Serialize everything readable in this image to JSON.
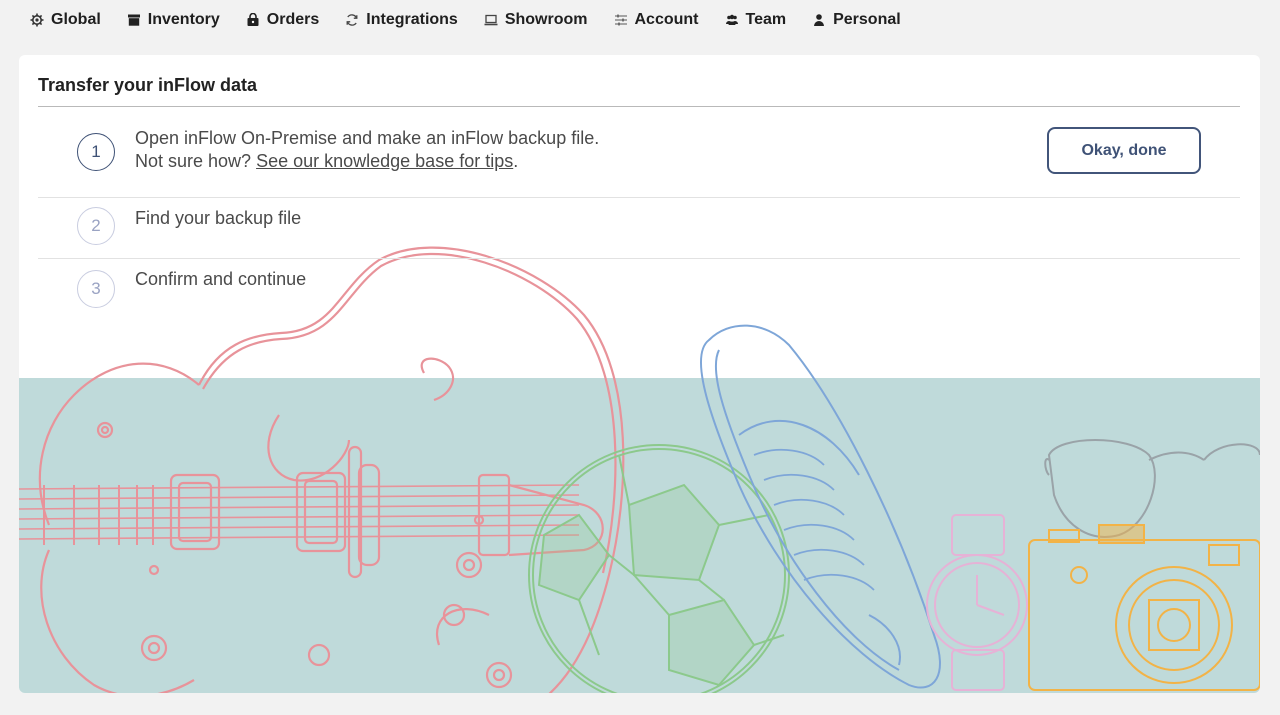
{
  "nav": {
    "items": [
      {
        "label": "Global",
        "icon": "gear-icon"
      },
      {
        "label": "Inventory",
        "icon": "box-icon"
      },
      {
        "label": "Orders",
        "icon": "bag-icon"
      },
      {
        "label": "Integrations",
        "icon": "sync-icon"
      },
      {
        "label": "Showroom",
        "icon": "laptop-icon"
      },
      {
        "label": "Account",
        "icon": "sliders-icon"
      },
      {
        "label": "Team",
        "icon": "users-icon"
      },
      {
        "label": "Personal",
        "icon": "user-icon"
      }
    ]
  },
  "card": {
    "title": "Transfer your inFlow data",
    "steps": [
      {
        "number": "1",
        "line1": "Open inFlow On-Premise and make an inFlow backup file.",
        "line2_prefix": "Not sure how? ",
        "line2_link": "See our knowledge base for tips",
        "line2_suffix": "."
      },
      {
        "number": "2",
        "text": "Find your backup file"
      },
      {
        "number": "3",
        "text": "Confirm and continue"
      }
    ],
    "okay_button": "Okay, done"
  },
  "colors": {
    "accent": "#3f5276",
    "illustration_bg": "#bfdada",
    "guitar": "#e8939a",
    "ball": "#8cc98c",
    "shoe": "#7ea6d8",
    "watch": "#e6b2d6",
    "camera": "#f2b347",
    "glasses": "#9aa3a8"
  }
}
